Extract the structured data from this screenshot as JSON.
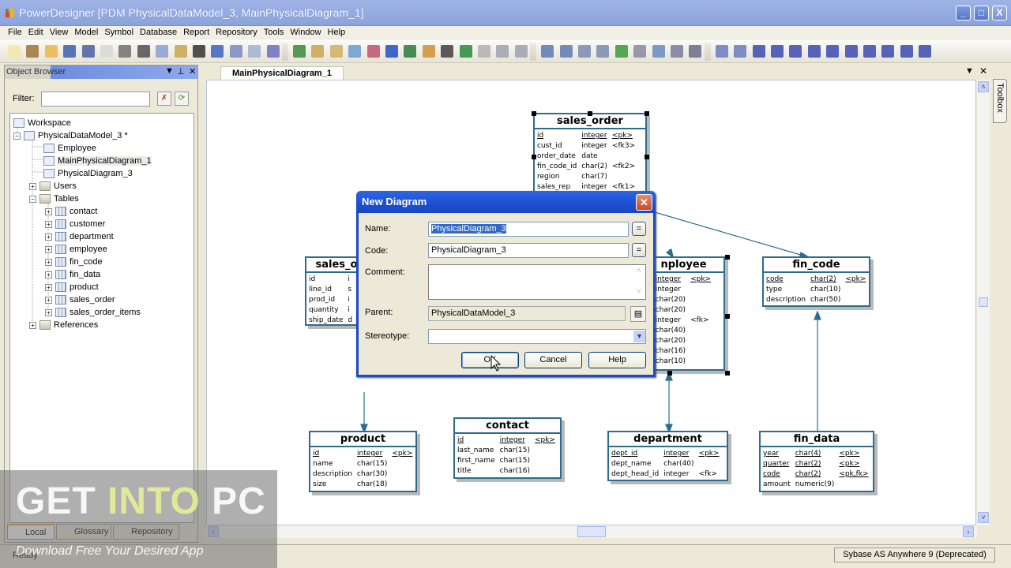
{
  "window": {
    "title": "PowerDesigner [PDM PhysicalDataModel_3, MainPhysicalDiagram_1]",
    "minimize": "_",
    "maximize": "□",
    "close": "X"
  },
  "menu": [
    "File",
    "Edit",
    "View",
    "Model",
    "Symbol",
    "Database",
    "Report",
    "Repository",
    "Tools",
    "Window",
    "Help"
  ],
  "toolbar_icons": [
    "new-icon",
    "new-project-icon",
    "open-icon",
    "save-icon",
    "save-all-icon",
    "print-preview-icon",
    "print-icon",
    "cut-icon",
    "copy-icon",
    "paste-icon",
    "delete-icon",
    "undo-icon",
    "redo-icon",
    "properties-icon",
    "help-icon",
    "new-diagram-icon",
    "paste-as-shortcut-icon",
    "find-icon",
    "refresh-icon",
    "check-model-icon",
    "shadow-icon",
    "text-format-icon",
    "line-style-icon",
    "fill-icon",
    "font-icon",
    "export-icon",
    "back-icon",
    "forward-icon",
    "diagram-icon",
    "package-diagram-icon",
    "page-icon",
    "multi-page-icon",
    "generate-icon",
    "diagram-graph-icon",
    "zoom-icon",
    "list-icon",
    "grid-icon",
    "auto-layout-icon",
    "layout-icon",
    "align-left-icon",
    "align-center-icon",
    "align-right-icon",
    "same-width-icon",
    "distribute-horizontal-icon",
    "align-top-icon",
    "align-middle-icon",
    "align-bottom-icon",
    "same-height-icon",
    "distribute-vertical-icon"
  ],
  "browser": {
    "title": "Object Browser",
    "filter_label": "Filter:",
    "filter_value": "",
    "tree": {
      "workspace": "Workspace",
      "model": "PhysicalDataModel_3 *",
      "diagrams": [
        "Employee",
        "MainPhysicalDiagram_1",
        "PhysicalDiagram_3"
      ],
      "users": "Users",
      "tables_folder": "Tables",
      "tables": [
        "contact",
        "customer",
        "department",
        "employee",
        "fin_code",
        "fin_data",
        "product",
        "sales_order",
        "sales_order_items"
      ],
      "references": "References"
    },
    "tabs": [
      "Local",
      "Glossary",
      "Repository"
    ]
  },
  "document_tab": "MainPhysicalDiagram_1",
  "toolbox_label": "Toolbox",
  "entities": {
    "sales_order": {
      "name": "sales_order",
      "cols": [
        [
          "id",
          "integer",
          "<pk>"
        ],
        [
          "cust_id",
          "integer",
          "<fk3>"
        ],
        [
          "order_date",
          "date",
          ""
        ],
        [
          "fin_code_id",
          "char(2)",
          "<fk2>"
        ],
        [
          "region",
          "char(7)",
          ""
        ],
        [
          "sales_rep",
          "integer",
          "<fk1>"
        ]
      ]
    },
    "sales_order_items": {
      "name": "sales_o",
      "cols": [
        [
          "id",
          "i"
        ],
        [
          "line_id",
          "s"
        ],
        [
          "prod_id",
          "i"
        ],
        [
          "quantity",
          "i"
        ],
        [
          "ship_date",
          "d"
        ]
      ]
    },
    "employee": {
      "name": "nployee",
      "cols": [
        [
          "",
          "integer",
          "<pk>"
        ],
        [
          "d",
          "integer",
          ""
        ],
        [
          "e",
          "char(20)",
          ""
        ],
        [
          "e",
          "char(20)",
          ""
        ],
        [
          "",
          "integer",
          "<fk>"
        ],
        [
          "",
          "char(40)",
          ""
        ],
        [
          "",
          "char(20)",
          ""
        ],
        [
          "",
          "char(16)",
          ""
        ],
        [
          "",
          "char(10)",
          ""
        ]
      ]
    },
    "fin_code": {
      "name": "fin_code",
      "cols": [
        [
          "code",
          "char(2)",
          "<pk>"
        ],
        [
          "type",
          "char(10)",
          ""
        ],
        [
          "description",
          "char(50)",
          ""
        ]
      ]
    },
    "product": {
      "name": "product",
      "cols": [
        [
          "id",
          "integer",
          "<pk>"
        ],
        [
          "name",
          "char(15)",
          ""
        ],
        [
          "description",
          "char(30)",
          ""
        ],
        [
          "size",
          "char(18)",
          ""
        ]
      ]
    },
    "contact": {
      "name": "contact",
      "cols": [
        [
          "id",
          "integer",
          "<pk>"
        ],
        [
          "last_name",
          "char(15)",
          ""
        ],
        [
          "first_name",
          "char(15)",
          ""
        ],
        [
          "title",
          "char(16)",
          ""
        ]
      ]
    },
    "department": {
      "name": "department",
      "cols": [
        [
          "dept_id",
          "integer",
          "<pk>"
        ],
        [
          "dept_name",
          "char(40)",
          ""
        ],
        [
          "dept_head_id",
          "integer",
          "<fk>"
        ]
      ]
    },
    "fin_data": {
      "name": "fin_data",
      "cols": [
        [
          "year",
          "char(4)",
          "<pk>"
        ],
        [
          "quarter",
          "char(2)",
          "<pk>"
        ],
        [
          "code",
          "char(2)",
          "<pk,fk>"
        ],
        [
          "amount",
          "numeric(9)",
          ""
        ]
      ]
    }
  },
  "dialog": {
    "title": "New Diagram",
    "name_label": "Name:",
    "name_value": "PhysicalDiagram_3",
    "code_label": "Code:",
    "code_value": "PhysicalDiagram_3",
    "comment_label": "Comment:",
    "comment_value": "",
    "parent_label": "Parent:",
    "parent_value": "PhysicalDataModel_3",
    "stereotype_label": "Stereotype:",
    "stereotype_value": "",
    "eq_button": "=",
    "ok": "OK",
    "cancel": "Cancel",
    "help": "Help"
  },
  "status": {
    "ready": "Ready",
    "dbms": "Sybase AS Anywhere 9 (Deprecated)"
  },
  "watermark": {
    "get": "GET ",
    "into": "INTO",
    "pc": " PC",
    "tagline": "Download Free Your Desired App"
  }
}
